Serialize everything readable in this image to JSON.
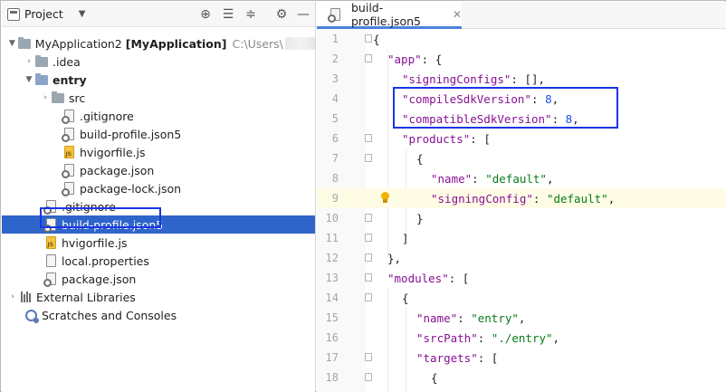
{
  "project_panel": {
    "title": "Project",
    "tree": [
      {
        "label": "MyApplication2",
        "module": "[MyApplication]",
        "path": "C:\\Users\\"
      },
      {
        "label": ".idea"
      },
      {
        "label": "entry"
      },
      {
        "label": "src"
      },
      {
        "label": ".gitignore"
      },
      {
        "label": "build-profile.json5"
      },
      {
        "label": "hvigorfile.js"
      },
      {
        "label": "package.json"
      },
      {
        "label": "package-lock.json"
      },
      {
        "label": ".gitignore"
      },
      {
        "label": "build-profile.json5"
      },
      {
        "label": "hvigorfile.js"
      },
      {
        "label": "local.properties"
      },
      {
        "label": "package.json"
      },
      {
        "label": "External Libraries"
      },
      {
        "label": "Scratches and Consoles"
      }
    ]
  },
  "editor": {
    "tab_label": "build-profile.json5",
    "lines": [
      {
        "num": "1"
      },
      {
        "num": "2"
      },
      {
        "num": "3"
      },
      {
        "num": "4"
      },
      {
        "num": "5"
      },
      {
        "num": "6"
      },
      {
        "num": "7"
      },
      {
        "num": "8"
      },
      {
        "num": "9"
      },
      {
        "num": "10"
      },
      {
        "num": "11"
      },
      {
        "num": "12"
      },
      {
        "num": "13"
      },
      {
        "num": "14"
      },
      {
        "num": "15"
      },
      {
        "num": "16"
      },
      {
        "num": "17"
      },
      {
        "num": "18"
      }
    ],
    "code": {
      "l1_brace": "{",
      "l2_key": "\"app\"",
      "l2_rest": ": {",
      "l3_key": "\"signingConfigs\"",
      "l3_rest": ": [],",
      "l4_key": "\"compileSdkVersion\"",
      "l4_colon": ": ",
      "l4_val": "8",
      "l4_comma": ",",
      "l5_key": "\"compatibleSdkVersion\"",
      "l5_colon": ": ",
      "l5_val": "8",
      "l5_comma": ",",
      "l6_key": "\"products\"",
      "l6_rest": ": [",
      "l7_brace": "{",
      "l8_key": "\"name\"",
      "l8_colon": ": ",
      "l8_val": "\"default\"",
      "l8_comma": ",",
      "l9_key": "\"signingConfig\"",
      "l9_colon": ": ",
      "l9_val": "\"default\"",
      "l9_comma": ",",
      "l10_brace": "}",
      "l11_bracket": "]",
      "l12_close": "},",
      "l13_key": "\"modules\"",
      "l13_rest": ": [",
      "l14_brace": "{",
      "l15_key": "\"name\"",
      "l15_colon": ": ",
      "l15_val": "\"entry\"",
      "l15_comma": ",",
      "l16_key": "\"srcPath\"",
      "l16_colon": ": ",
      "l16_val": "\"./entry\"",
      "l16_comma": ",",
      "l17_key": "\"targets\"",
      "l17_rest": ": [",
      "l18_brace": "{"
    }
  },
  "icons": {
    "project": "project-panel-icon",
    "locate": "crosshair-icon",
    "expand": "expand-all-icon",
    "collapse": "collapse-all-icon",
    "settings": "gear-icon",
    "hide": "minus-icon",
    "bulb": "lightbulb-icon"
  },
  "colors": {
    "selection": "#2f65ca",
    "highlight_box": "#1b34e6",
    "json_key": "#871094",
    "json_string": "#067d17",
    "json_number": "#1750eb"
  }
}
